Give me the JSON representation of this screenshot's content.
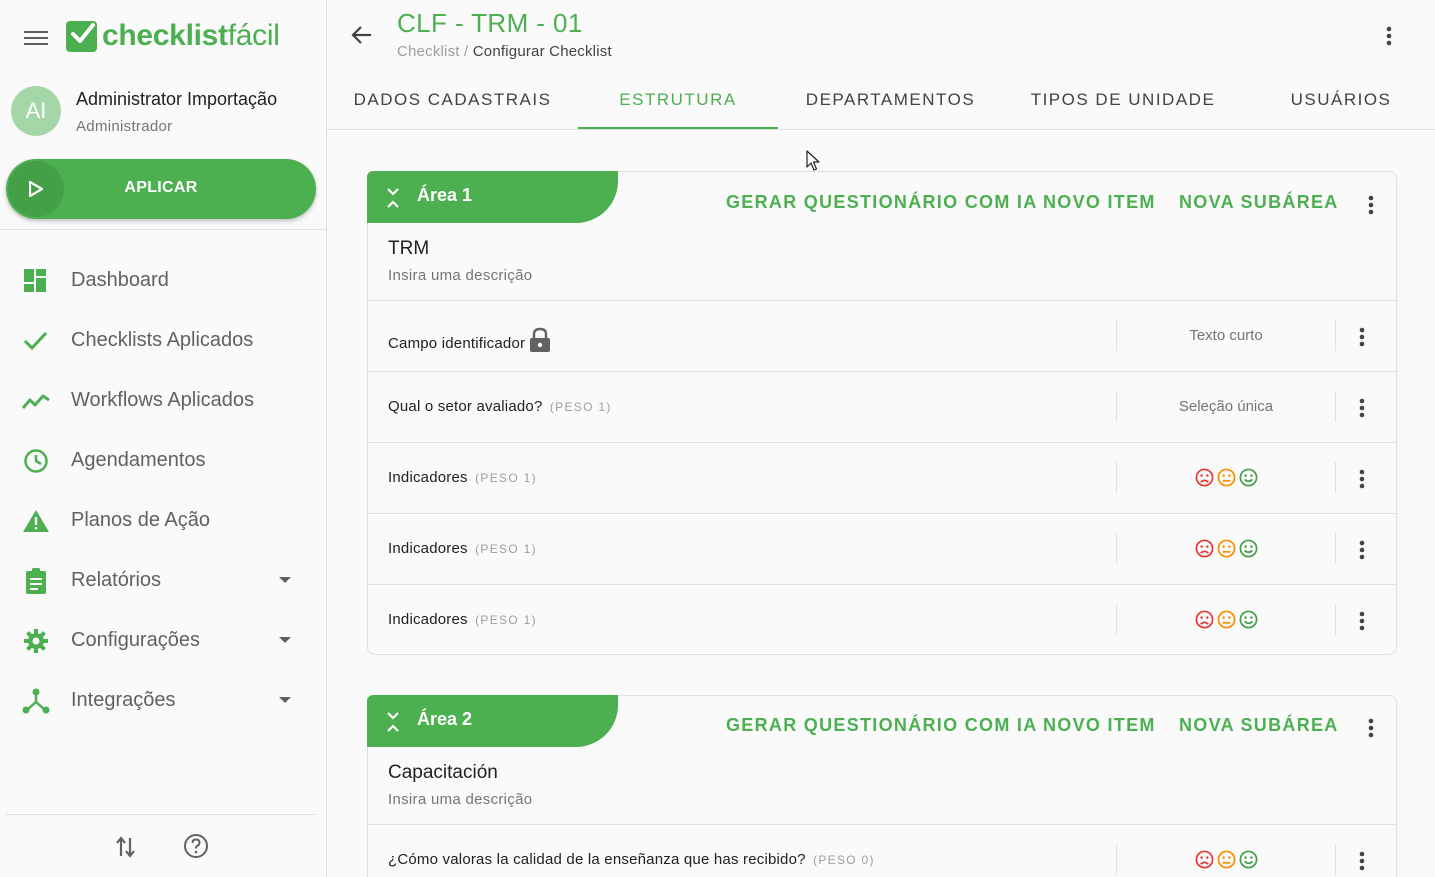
{
  "app": {
    "logo_bold": "checklist",
    "logo_light": "fácil",
    "user": {
      "initials": "AI",
      "name": "Administrator Importação",
      "role": "Administrador"
    },
    "apply_label": "APLICAR"
  },
  "sidebar": {
    "items": [
      {
        "label": "Dashboard",
        "icon": "dashboard-icon",
        "has_caret": false
      },
      {
        "label": "Checklists Aplicados",
        "icon": "check-icon",
        "has_caret": false
      },
      {
        "label": "Workflows Aplicados",
        "icon": "trending-icon",
        "has_caret": false
      },
      {
        "label": "Agendamentos",
        "icon": "clock-icon",
        "has_caret": false
      },
      {
        "label": "Planos de Ação",
        "icon": "warning-icon",
        "has_caret": false
      },
      {
        "label": "Relatórios",
        "icon": "clipboard-icon",
        "has_caret": true
      },
      {
        "label": "Configurações",
        "icon": "gear-icon",
        "has_caret": true
      },
      {
        "label": "Integrações",
        "icon": "integration-icon",
        "has_caret": true
      }
    ]
  },
  "header": {
    "title": "CLF - TRM - 01",
    "breadcrumb_parent": "Checklist",
    "breadcrumb_sep": " / ",
    "breadcrumb_current": "Configurar Checklist"
  },
  "tabs": [
    {
      "label": "DADOS CADASTRAIS",
      "active": false
    },
    {
      "label": "ESTRUTURA",
      "active": true
    },
    {
      "label": "DEPARTAMENTOS",
      "active": false
    },
    {
      "label": "TIPOS DE UNIDADE",
      "active": false
    },
    {
      "label": "USUÁRIOS",
      "active": false
    }
  ],
  "area_actions": {
    "generate_ai": "GERAR QUESTIONÁRIO COM IA",
    "new_item": "NOVO ITEM",
    "new_subarea": "NOVA SUBÁREA"
  },
  "areas": [
    {
      "name": "Área 1",
      "title": "TRM",
      "description": "Insira uma descrição",
      "items": [
        {
          "label": "Campo identificador",
          "weight": "",
          "type": "Texto curto",
          "locked": true
        },
        {
          "label": "Qual o setor avaliado?",
          "weight": "(PESO 1)",
          "type": "Seleção única",
          "locked": false
        },
        {
          "label": "Indicadores",
          "weight": "(PESO 1)",
          "type": "faces",
          "locked": false
        },
        {
          "label": "Indicadores",
          "weight": "(PESO 1)",
          "type": "faces",
          "locked": false
        },
        {
          "label": "Indicadores",
          "weight": "(PESO 1)",
          "type": "faces",
          "locked": false
        }
      ]
    },
    {
      "name": "Área 2",
      "title": "Capacitación",
      "description": "Insira uma descrição",
      "items": [
        {
          "label": "¿Cómo valoras la calidad de la enseñanza que has recibido?",
          "weight": "(PESO 0)",
          "type": "faces",
          "locked": false
        }
      ]
    }
  ],
  "colors": {
    "brand": "#4caf50",
    "face_bad": "#e53935",
    "face_neutral": "#fb8c00",
    "face_good": "#43a047"
  }
}
